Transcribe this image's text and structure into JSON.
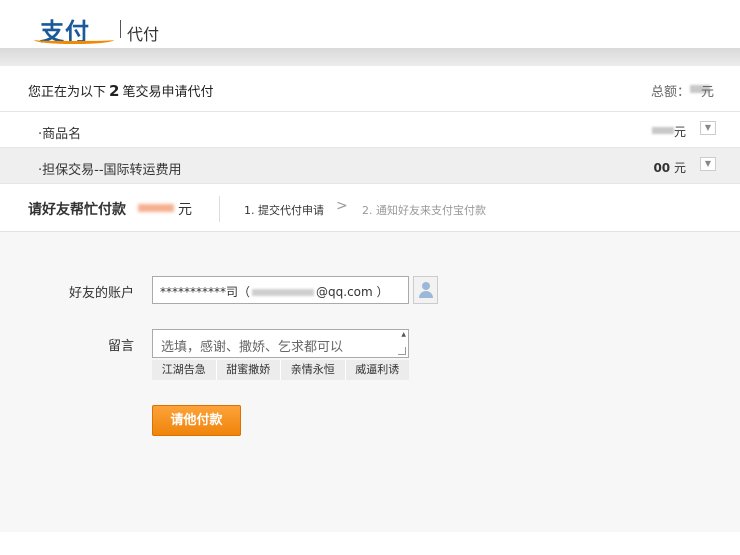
{
  "header": {
    "logo_text": "支付宝",
    "subtitle": "代付"
  },
  "summary": {
    "prefix": "您正在为以下",
    "count": "2",
    "suffix": "笔交易申请代付",
    "total_label": "总额：",
    "total_unit": "元"
  },
  "items": [
    {
      "name": "·商品名",
      "price": "",
      "unit": "元"
    },
    {
      "name": "·担保交易--国际转运费用",
      "price": "00",
      "unit": "元"
    }
  ],
  "steps": {
    "title": "请好友帮忙付款",
    "unit": "元",
    "step1": "1. 提交代付申请",
    "arrow": ">",
    "step2": "2. 通知好友来支付宝付款"
  },
  "form": {
    "account_label": "好友的账户",
    "account_prefix": "***********司（",
    "account_suffix": "@qq.com ）",
    "message_label": "留言",
    "message_placeholder": "选填，感谢、撒娇、乞求都可以",
    "chips": [
      "江湖告急",
      "甜蜜撒娇",
      "亲情永恒",
      "威逼利诱"
    ],
    "submit_label": "请他付款"
  },
  "colors": {
    "accent": "#f0840b",
    "brand": "#1a5a9a"
  }
}
